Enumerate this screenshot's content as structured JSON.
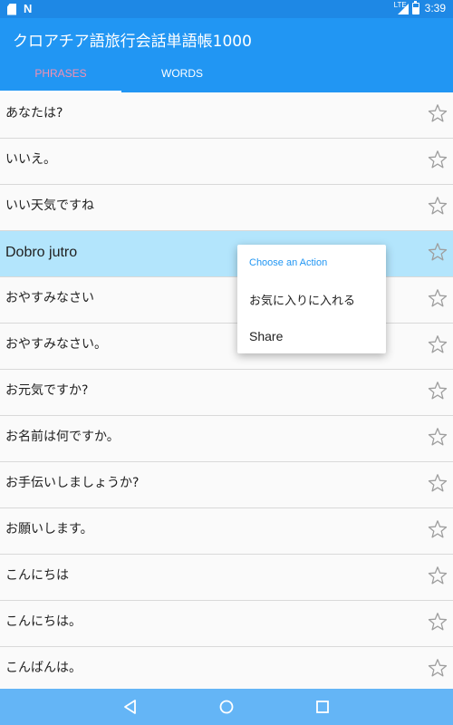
{
  "status_bar": {
    "time": "3:39",
    "network": "LTE",
    "notification_icons": [
      "sd-card-icon",
      "n-icon"
    ]
  },
  "app_bar": {
    "title": "クロアチア語旅行会話単語帳1000",
    "tabs": [
      {
        "label": "PHRASES",
        "selected": true
      },
      {
        "label": "WORDS",
        "selected": false
      }
    ]
  },
  "phrases": [
    {
      "text": "あなたは?",
      "highlighted": false
    },
    {
      "text": "いいえ。",
      "highlighted": false
    },
    {
      "text": "いい天気ですね",
      "highlighted": false
    },
    {
      "text": "Dobro jutro",
      "highlighted": true
    },
    {
      "text": "おやすみなさい",
      "highlighted": false
    },
    {
      "text": "おやすみなさい。",
      "highlighted": false
    },
    {
      "text": "お元気ですか?",
      "highlighted": false
    },
    {
      "text": "お名前は何ですか。",
      "highlighted": false
    },
    {
      "text": "お手伝いしましょうか?",
      "highlighted": false
    },
    {
      "text": "お願いします。",
      "highlighted": false
    },
    {
      "text": "こんにちは",
      "highlighted": false
    },
    {
      "text": "こんにちは。",
      "highlighted": false
    },
    {
      "text": "こんばんは。",
      "highlighted": false
    }
  ],
  "context_menu": {
    "title": "Choose an Action",
    "items": [
      "お気に入りに入れる",
      "Share"
    ]
  },
  "colors": {
    "primary": "#2196f3",
    "status_bar": "#1e88e5",
    "highlight_row": "#b3e5fc",
    "selected_tab_text": "#f48fb1",
    "nav_bar": "#64b5f6"
  }
}
